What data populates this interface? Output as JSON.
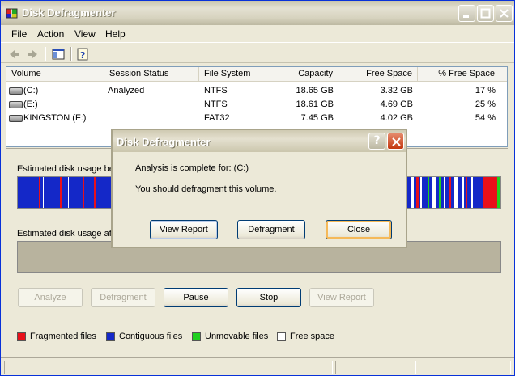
{
  "window": {
    "title": "Disk Defragmenter"
  },
  "menu": [
    "File",
    "Action",
    "View",
    "Help"
  ],
  "toolbar": {
    "icons": [
      "back-arrow-icon",
      "forward-arrow-icon",
      "show-hide-console-tree-icon",
      "help-icon"
    ]
  },
  "volumes": {
    "columns": [
      "Volume",
      "Session Status",
      "File System",
      "Capacity",
      "Free Space",
      "% Free Space"
    ],
    "rows": [
      {
        "volume": "(C:)",
        "status": "Analyzed",
        "fs": "NTFS",
        "capacity": "18.65 GB",
        "free": "3.32 GB",
        "pct": "17 %"
      },
      {
        "volume": "(E:)",
        "status": "",
        "fs": "NTFS",
        "capacity": "18.61 GB",
        "free": "4.69 GB",
        "pct": "25 %"
      },
      {
        "volume": "KINGSTON (F:)",
        "status": "",
        "fs": "FAT32",
        "capacity": "7.45 GB",
        "free": "4.02 GB",
        "pct": "54 %"
      }
    ]
  },
  "usage": {
    "before_label": "Estimated disk usage be",
    "after_label": "Estimated disk usage aft"
  },
  "buttons": {
    "analyze": "Analyze",
    "defragment": "Defragment",
    "pause": "Pause",
    "stop": "Stop",
    "view_report": "View Report"
  },
  "legend": [
    {
      "label": "Fragmented files",
      "color": "#e8101a"
    },
    {
      "label": "Contiguous files",
      "color": "#1428c8"
    },
    {
      "label": "Unmovable files",
      "color": "#20d020"
    },
    {
      "label": "Free space",
      "color": "#ffffff"
    }
  ],
  "dialog": {
    "title": "Disk Defragmenter",
    "help_glyph": "?",
    "message1": "Analysis is complete for: (C:)",
    "message2": "You should defragment this volume.",
    "view_report": "View Report",
    "defragment": "Defragment",
    "close": "Close"
  },
  "colors": {
    "fragmented": "#e8101a",
    "contiguous": "#1428c8",
    "unmovable": "#20d020",
    "free": "#ffffff"
  }
}
